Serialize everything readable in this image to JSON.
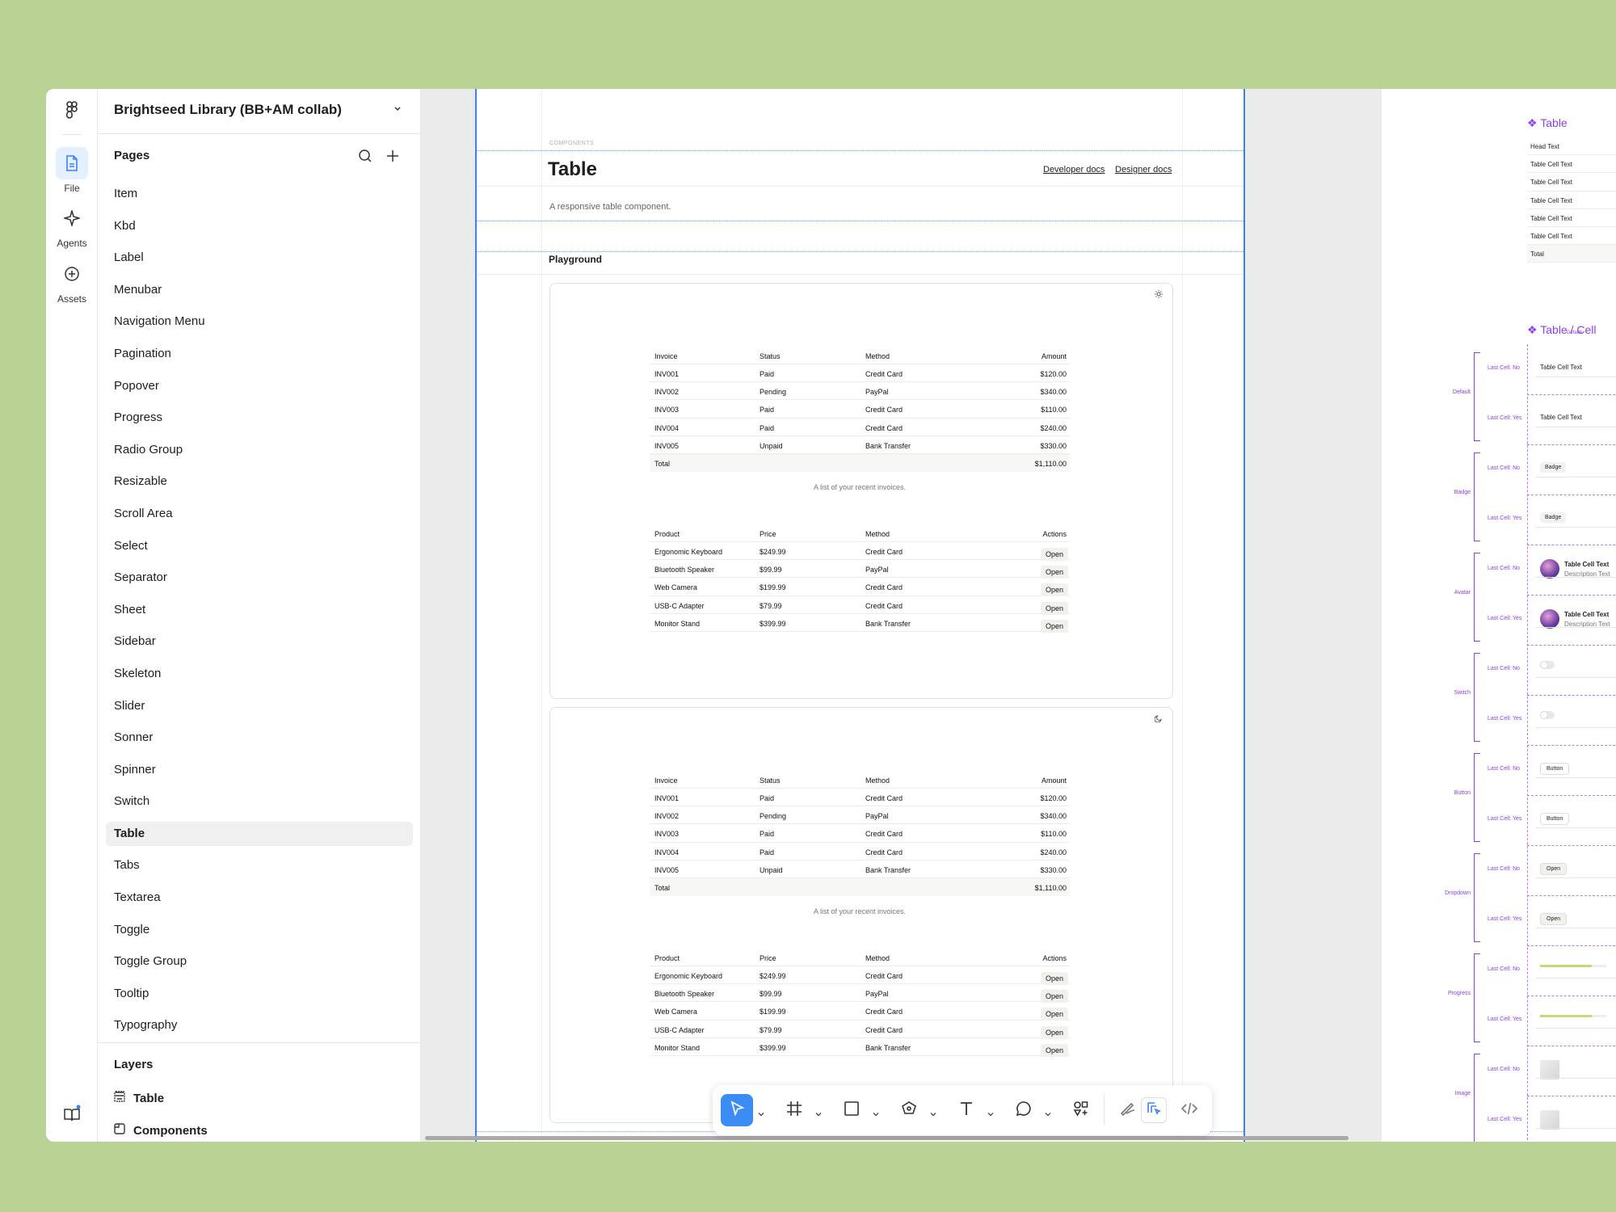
{
  "rail": {
    "file_label": "File",
    "agents_label": "Agents",
    "assets_label": "Assets"
  },
  "file": {
    "title": "Brightseed Library (BB+AM collab)"
  },
  "pages": {
    "title": "Pages",
    "items": [
      "Item",
      "Kbd",
      "Label",
      "Menubar",
      "Navigation Menu",
      "Pagination",
      "Popover",
      "Progress",
      "Radio Group",
      "Resizable",
      "Scroll Area",
      "Select",
      "Separator",
      "Sheet",
      "Sidebar",
      "Skeleton",
      "Slider",
      "Sonner",
      "Spinner",
      "Switch",
      "Table",
      "Tabs",
      "Textarea",
      "Toggle",
      "Toggle Group",
      "Tooltip",
      "Typography"
    ],
    "active": "Table"
  },
  "layers": {
    "title": "Layers",
    "items": [
      "Table",
      "Components"
    ]
  },
  "doc": {
    "section_label": "COMPONENTS",
    "title": "Table",
    "developer_docs": "Developer docs",
    "designer_docs": "Designer docs",
    "description": "A responsive table component.",
    "playground": "Playground"
  },
  "invoice_table": {
    "headers": [
      "Invoice",
      "Status",
      "Method",
      "Amount"
    ],
    "rows": [
      [
        "INV001",
        "Paid",
        "Credit Card",
        "$120.00"
      ],
      [
        "INV002",
        "Pending",
        "PayPal",
        "$340.00"
      ],
      [
        "INV003",
        "Paid",
        "Credit Card",
        "$110.00"
      ],
      [
        "INV004",
        "Paid",
        "Credit Card",
        "$240.00"
      ],
      [
        "INV005",
        "Unpaid",
        "Bank Transfer",
        "$330.00"
      ]
    ],
    "total_label": "Total",
    "total_value": "$1,110.00",
    "caption": "A list of your recent invoices."
  },
  "product_table": {
    "headers": [
      "Product",
      "Price",
      "Method",
      "Actions"
    ],
    "rows": [
      [
        "Ergonomic Keyboard",
        "$249.99",
        "Credit Card"
      ],
      [
        "Bluetooth Speaker",
        "$99.99",
        "PayPal"
      ],
      [
        "Web Camera",
        "$199.99",
        "Credit Card"
      ],
      [
        "USB-C Adapter",
        "$79.99",
        "Credit Card"
      ],
      [
        "Monitor Stand",
        "$399.99",
        "Bank Transfer"
      ]
    ],
    "action_label": "Open"
  },
  "right_panel": {
    "table_title": "Table",
    "head_text": "Head Text",
    "cell_text": "Table Cell Text",
    "total": "Total",
    "cell_title": "Table / Cell",
    "cell_subtitle": "Default",
    "groups": [
      "Default",
      "Badge",
      "Avatar",
      "Switch",
      "Button",
      "Dropdown",
      "Progress",
      "Image"
    ],
    "last_cell_no": "Last Cell: No",
    "last_cell_yes": "Last Cell: Yes",
    "badge_label": "Badge",
    "description_text": "Description Text",
    "button_label": "Button",
    "dropdown_label": "Open",
    "progress_value": 0.78
  },
  "colors": {
    "background": "#b9d394",
    "accent": "#3b8cf5",
    "component_purple": "#8b3fe8"
  }
}
